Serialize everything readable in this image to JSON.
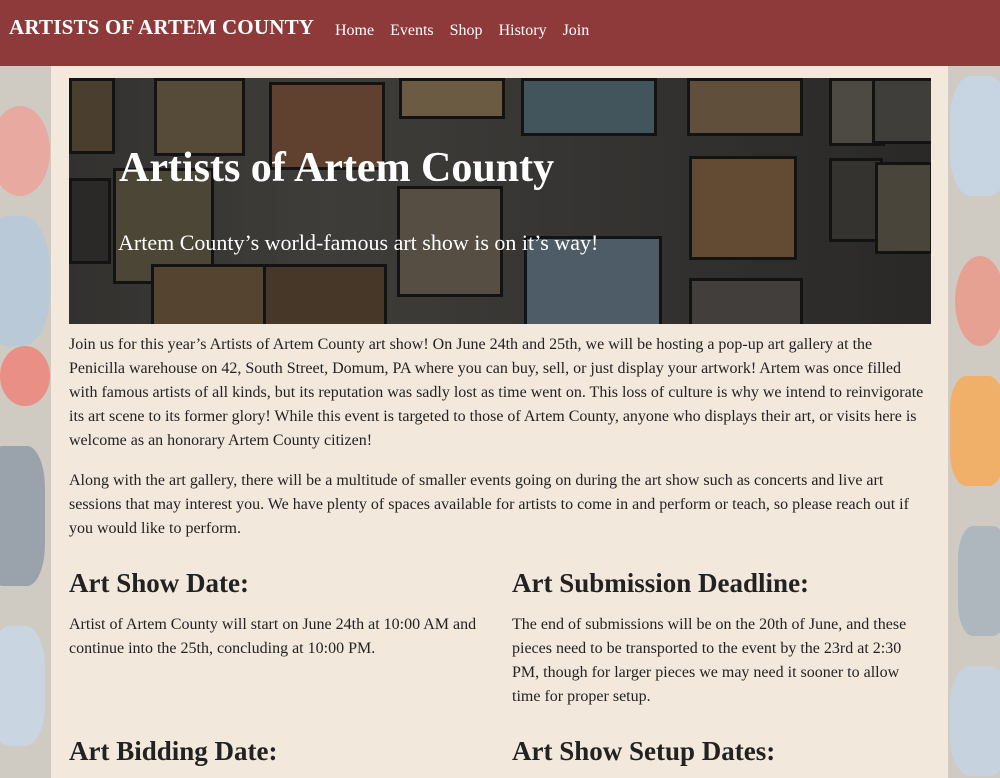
{
  "nav": {
    "brand": "ARTISTS OF ARTEM COUNTY",
    "links": [
      "Home",
      "Events",
      "Shop",
      "History",
      "Join"
    ]
  },
  "hero": {
    "title": "Artists of Artem County",
    "subtitle": "Artem County’s world-famous art show is on it’s way!"
  },
  "intro": {
    "p1": "Join us for this year’s Artists of Artem County art show! On June 24th and 25th, we will be hosting a pop-up art gallery at the Penicilla warehouse on 42, South Street, Domum, PA where you can buy, sell, or just display your artwork! Artem was once filled with famous artists of all kinds, but its reputation was sadly lost as time went on. This loss of culture is why we intend to reinvigorate its art scene to its former glory! While this event is targeted to those of Artem County, anyone who displays their art, or visits here is welcome as an honorary Artem County citizen!",
    "p2": "Along with the art gallery, there will be a multitude of smaller events going on during the art show such as concerts and live art sessions that may interest you. We have plenty of spaces available for artists to come in and perform or teach, so please reach out if you would like to perform."
  },
  "sections": [
    {
      "heading": "Art Show Date:",
      "text": "Artist of Artem County will start on June 24th at 10:00 AM and continue into the 25th, concluding at 10:00 PM."
    },
    {
      "heading": "Art Submission Deadline:",
      "text": "The end of submissions will be on the 20th of June, and these pieces need to be transported to the event by the 23rd at 2:30 PM, though for larger pieces we may need it sooner to allow time for proper setup."
    },
    {
      "heading": "Art Bidding Date:",
      "text": ""
    },
    {
      "heading": "Art Show Setup Dates:",
      "text": ""
    }
  ],
  "colors": {
    "navbar": "#8f3a3a",
    "content_bg": "#f3e8dc"
  }
}
